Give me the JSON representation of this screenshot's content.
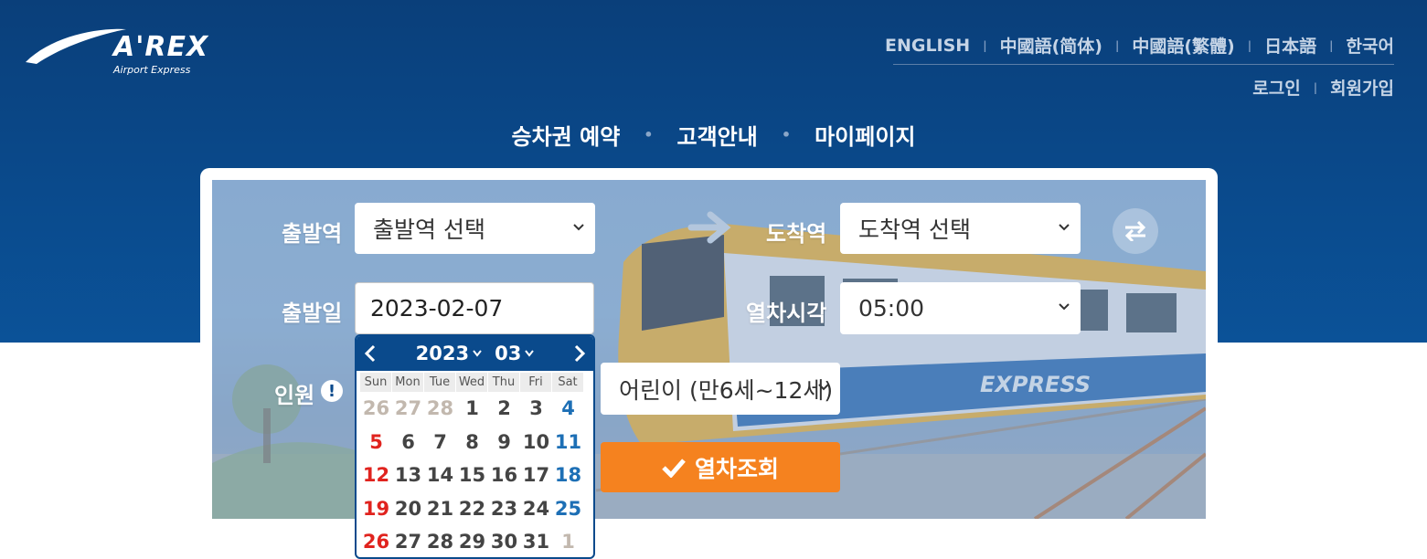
{
  "logo": {
    "brand": "A'REX",
    "sub": "Airport Express"
  },
  "languages": [
    "ENGLISH",
    "中國語(简体)",
    "中國語(繁體)",
    "日本語",
    "한국어"
  ],
  "account": {
    "login": "로그인",
    "signup": "회원가입"
  },
  "main_nav": [
    "승차권 예약",
    "고객안내",
    "마이페이지"
  ],
  "form": {
    "departure_label": "출발역",
    "departure_value": "출발역 선택",
    "arrival_label": "도착역",
    "arrival_value": "도착역 선택",
    "date_label": "출발일",
    "date_value": "2023-02-07",
    "time_label": "열차시각",
    "time_value": "05:00",
    "passengers_label": "인원",
    "passenger_type_value": "어린이 (만6세~12세)",
    "search_label": "열차조회"
  },
  "datepicker": {
    "year": "2023",
    "month": "03",
    "weekdays": [
      "Sun",
      "Mon",
      "Tue",
      "Wed",
      "Thu",
      "Fri",
      "Sat"
    ],
    "weeks": [
      [
        "26",
        "27",
        "28",
        "1",
        "2",
        "3",
        "4"
      ],
      [
        "5",
        "6",
        "7",
        "8",
        "9",
        "10",
        "11"
      ],
      [
        "12",
        "13",
        "14",
        "15",
        "16",
        "17",
        "18"
      ],
      [
        "19",
        "20",
        "21",
        "22",
        "23",
        "24",
        "25"
      ],
      [
        "26",
        "27",
        "28",
        "29",
        "30",
        "31",
        "1"
      ]
    ],
    "other_month_cells": [
      [
        0,
        0
      ],
      [
        0,
        1
      ],
      [
        0,
        2
      ],
      [
        4,
        6
      ]
    ]
  },
  "colors": {
    "brand_blue": "#0a4a8c",
    "search_orange": "#f5821f",
    "sunday_red": "#e0231e",
    "saturday_blue": "#1d6fb5"
  }
}
